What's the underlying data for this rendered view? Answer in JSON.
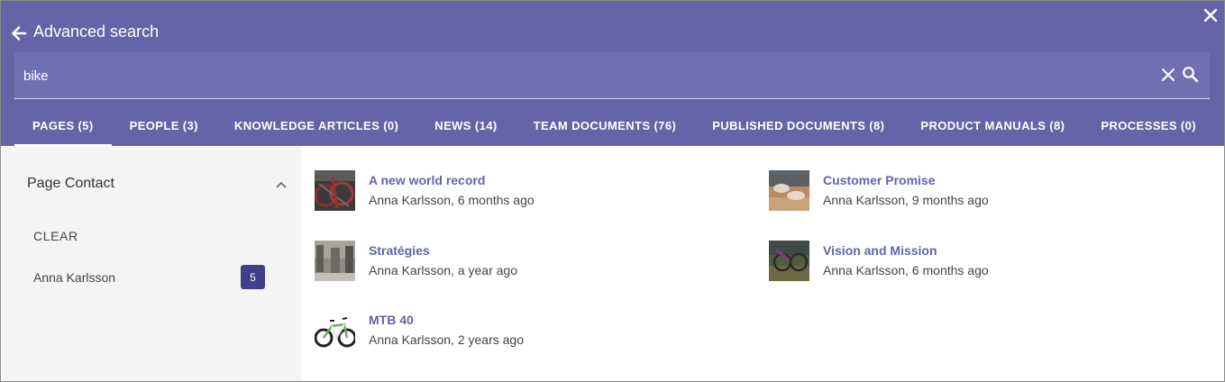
{
  "header": {
    "title": "Advanced search"
  },
  "search": {
    "value": "bike",
    "placeholder": ""
  },
  "tabs": [
    {
      "label": "PAGES (5)",
      "active": true
    },
    {
      "label": "PEOPLE (3)",
      "active": false
    },
    {
      "label": "KNOWLEDGE ARTICLES (0)",
      "active": false
    },
    {
      "label": "NEWS (14)",
      "active": false
    },
    {
      "label": "TEAM DOCUMENTS (76)",
      "active": false
    },
    {
      "label": "PUBLISHED DOCUMENTS (8)",
      "active": false
    },
    {
      "label": "PRODUCT MANUALS (8)",
      "active": false
    },
    {
      "label": "PROCESSES (0)",
      "active": false
    }
  ],
  "sidebar": {
    "facet_title": "Page Contact",
    "clear_label": "CLEAR",
    "items": [
      {
        "label": "Anna Karlsson",
        "count": "5"
      }
    ]
  },
  "results": [
    {
      "title": "A new world record",
      "meta": "Anna Karlsson, 6 months ago"
    },
    {
      "title": "Customer Promise",
      "meta": "Anna Karlsson, 9 months ago"
    },
    {
      "title": "Stratégies",
      "meta": "Anna Karlsson, a year ago"
    },
    {
      "title": "Vision and Mission",
      "meta": "Anna Karlsson, 6 months ago"
    },
    {
      "title": "MTB 40",
      "meta": "Anna Karlsson, 2 years ago"
    }
  ],
  "colors": {
    "header_bg": "#6464a8",
    "accent": "#6364a8",
    "badge": "#3f4089"
  }
}
